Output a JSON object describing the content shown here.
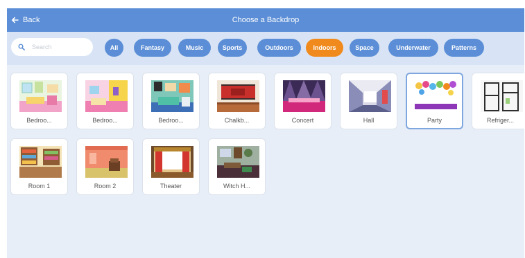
{
  "header": {
    "back_label": "Back",
    "title": "Choose a Backdrop"
  },
  "search": {
    "placeholder": "Search"
  },
  "categories": [
    "All",
    "Fantasy",
    "Music",
    "Sports",
    "Outdoors",
    "Indoors",
    "Space",
    "Underwater",
    "Patterns"
  ],
  "active_category": "Indoors",
  "backdrops": [
    {
      "label": "Bedroo...",
      "selected": false
    },
    {
      "label": "Bedroo...",
      "selected": false
    },
    {
      "label": "Bedroo...",
      "selected": false
    },
    {
      "label": "Chalkb...",
      "selected": false
    },
    {
      "label": "Concert",
      "selected": false
    },
    {
      "label": "Hall",
      "selected": false
    },
    {
      "label": "Party",
      "selected": true
    },
    {
      "label": "Refriger...",
      "selected": false
    },
    {
      "label": "Room 1",
      "selected": false
    },
    {
      "label": "Room 2",
      "selected": false
    },
    {
      "label": "Theater",
      "selected": false
    },
    {
      "label": "Witch H...",
      "selected": false
    }
  ],
  "colors": {
    "header": "#5b8ed6",
    "filter_bar": "#d8e4f5",
    "active_pill": "#f08a1c",
    "pill": "#5b8ed6"
  }
}
